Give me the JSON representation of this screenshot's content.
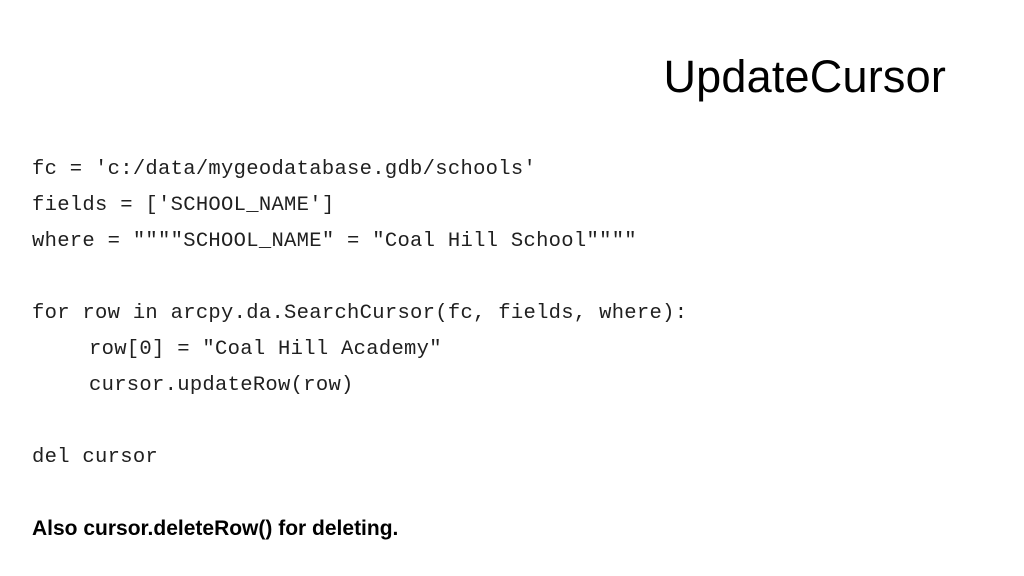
{
  "slide": {
    "title": "UpdateCursor",
    "background_color": "#ffffff",
    "title_color": "#000000",
    "code_color": "#202020",
    "note_color": "#000000"
  },
  "code": {
    "lines": [
      {
        "text": "fc = 'c:/data/mygeodatabase.gdb/schools'",
        "indent": 0
      },
      {
        "text": "fields = ['SCHOOL_NAME']",
        "indent": 0
      },
      {
        "text": "where = \"\"\"\"SCHOOL_NAME\" = \"Coal Hill School\"\"\"\"",
        "indent": 0
      },
      {
        "text": "",
        "indent": 0
      },
      {
        "text": "for row in arcpy.da.SearchCursor(fc, fields, where):",
        "indent": 0
      },
      {
        "text": "row[0] = \"Coal Hill Academy\"",
        "indent": 1
      },
      {
        "text": "cursor.updateRow(row)",
        "indent": 1
      },
      {
        "text": "",
        "indent": 0
      },
      {
        "text": "del cursor",
        "indent": 0
      }
    ]
  },
  "footer": {
    "note": "Also cursor.deleteRow() for deleting."
  }
}
